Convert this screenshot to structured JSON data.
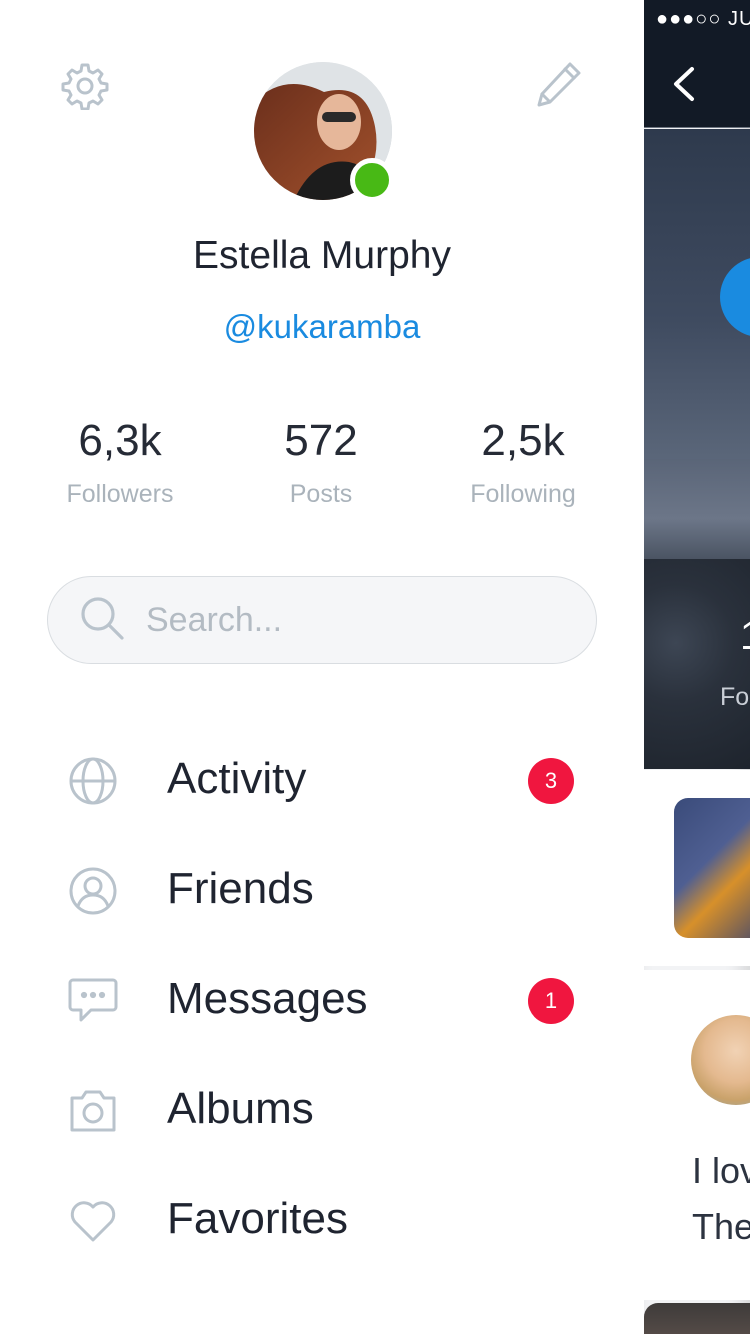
{
  "profile": {
    "name": "Estella Murphy",
    "handle": "@kukaramba",
    "status_color": "#48b915"
  },
  "stats": [
    {
      "value": "6,3k",
      "label": "Followers"
    },
    {
      "value": "572",
      "label": "Posts"
    },
    {
      "value": "2,5k",
      "label": "Following"
    }
  ],
  "search": {
    "placeholder": "Search...",
    "value": ""
  },
  "menu": [
    {
      "label": "Activity",
      "icon": "globe-icon",
      "badge": "3"
    },
    {
      "label": "Friends",
      "icon": "user-circle-icon",
      "badge": ""
    },
    {
      "label": "Messages",
      "icon": "chat-bubble-icon",
      "badge": "1"
    },
    {
      "label": "Albums",
      "icon": "camera-icon",
      "badge": ""
    },
    {
      "label": "Favorites",
      "icon": "heart-icon",
      "badge": ""
    }
  ],
  "header_icons": {
    "left": "gear-icon",
    "right": "pencil-icon"
  },
  "peek": {
    "status_text": "●●●○○ JU",
    "hero_number": "1",
    "hero_label": "Fo",
    "post_line1": "I lov",
    "post_line2": "The"
  },
  "colors": {
    "accent": "#1a8be0",
    "badge": "#f0163f",
    "icon": "#b9c3cc",
    "online": "#48b915"
  }
}
